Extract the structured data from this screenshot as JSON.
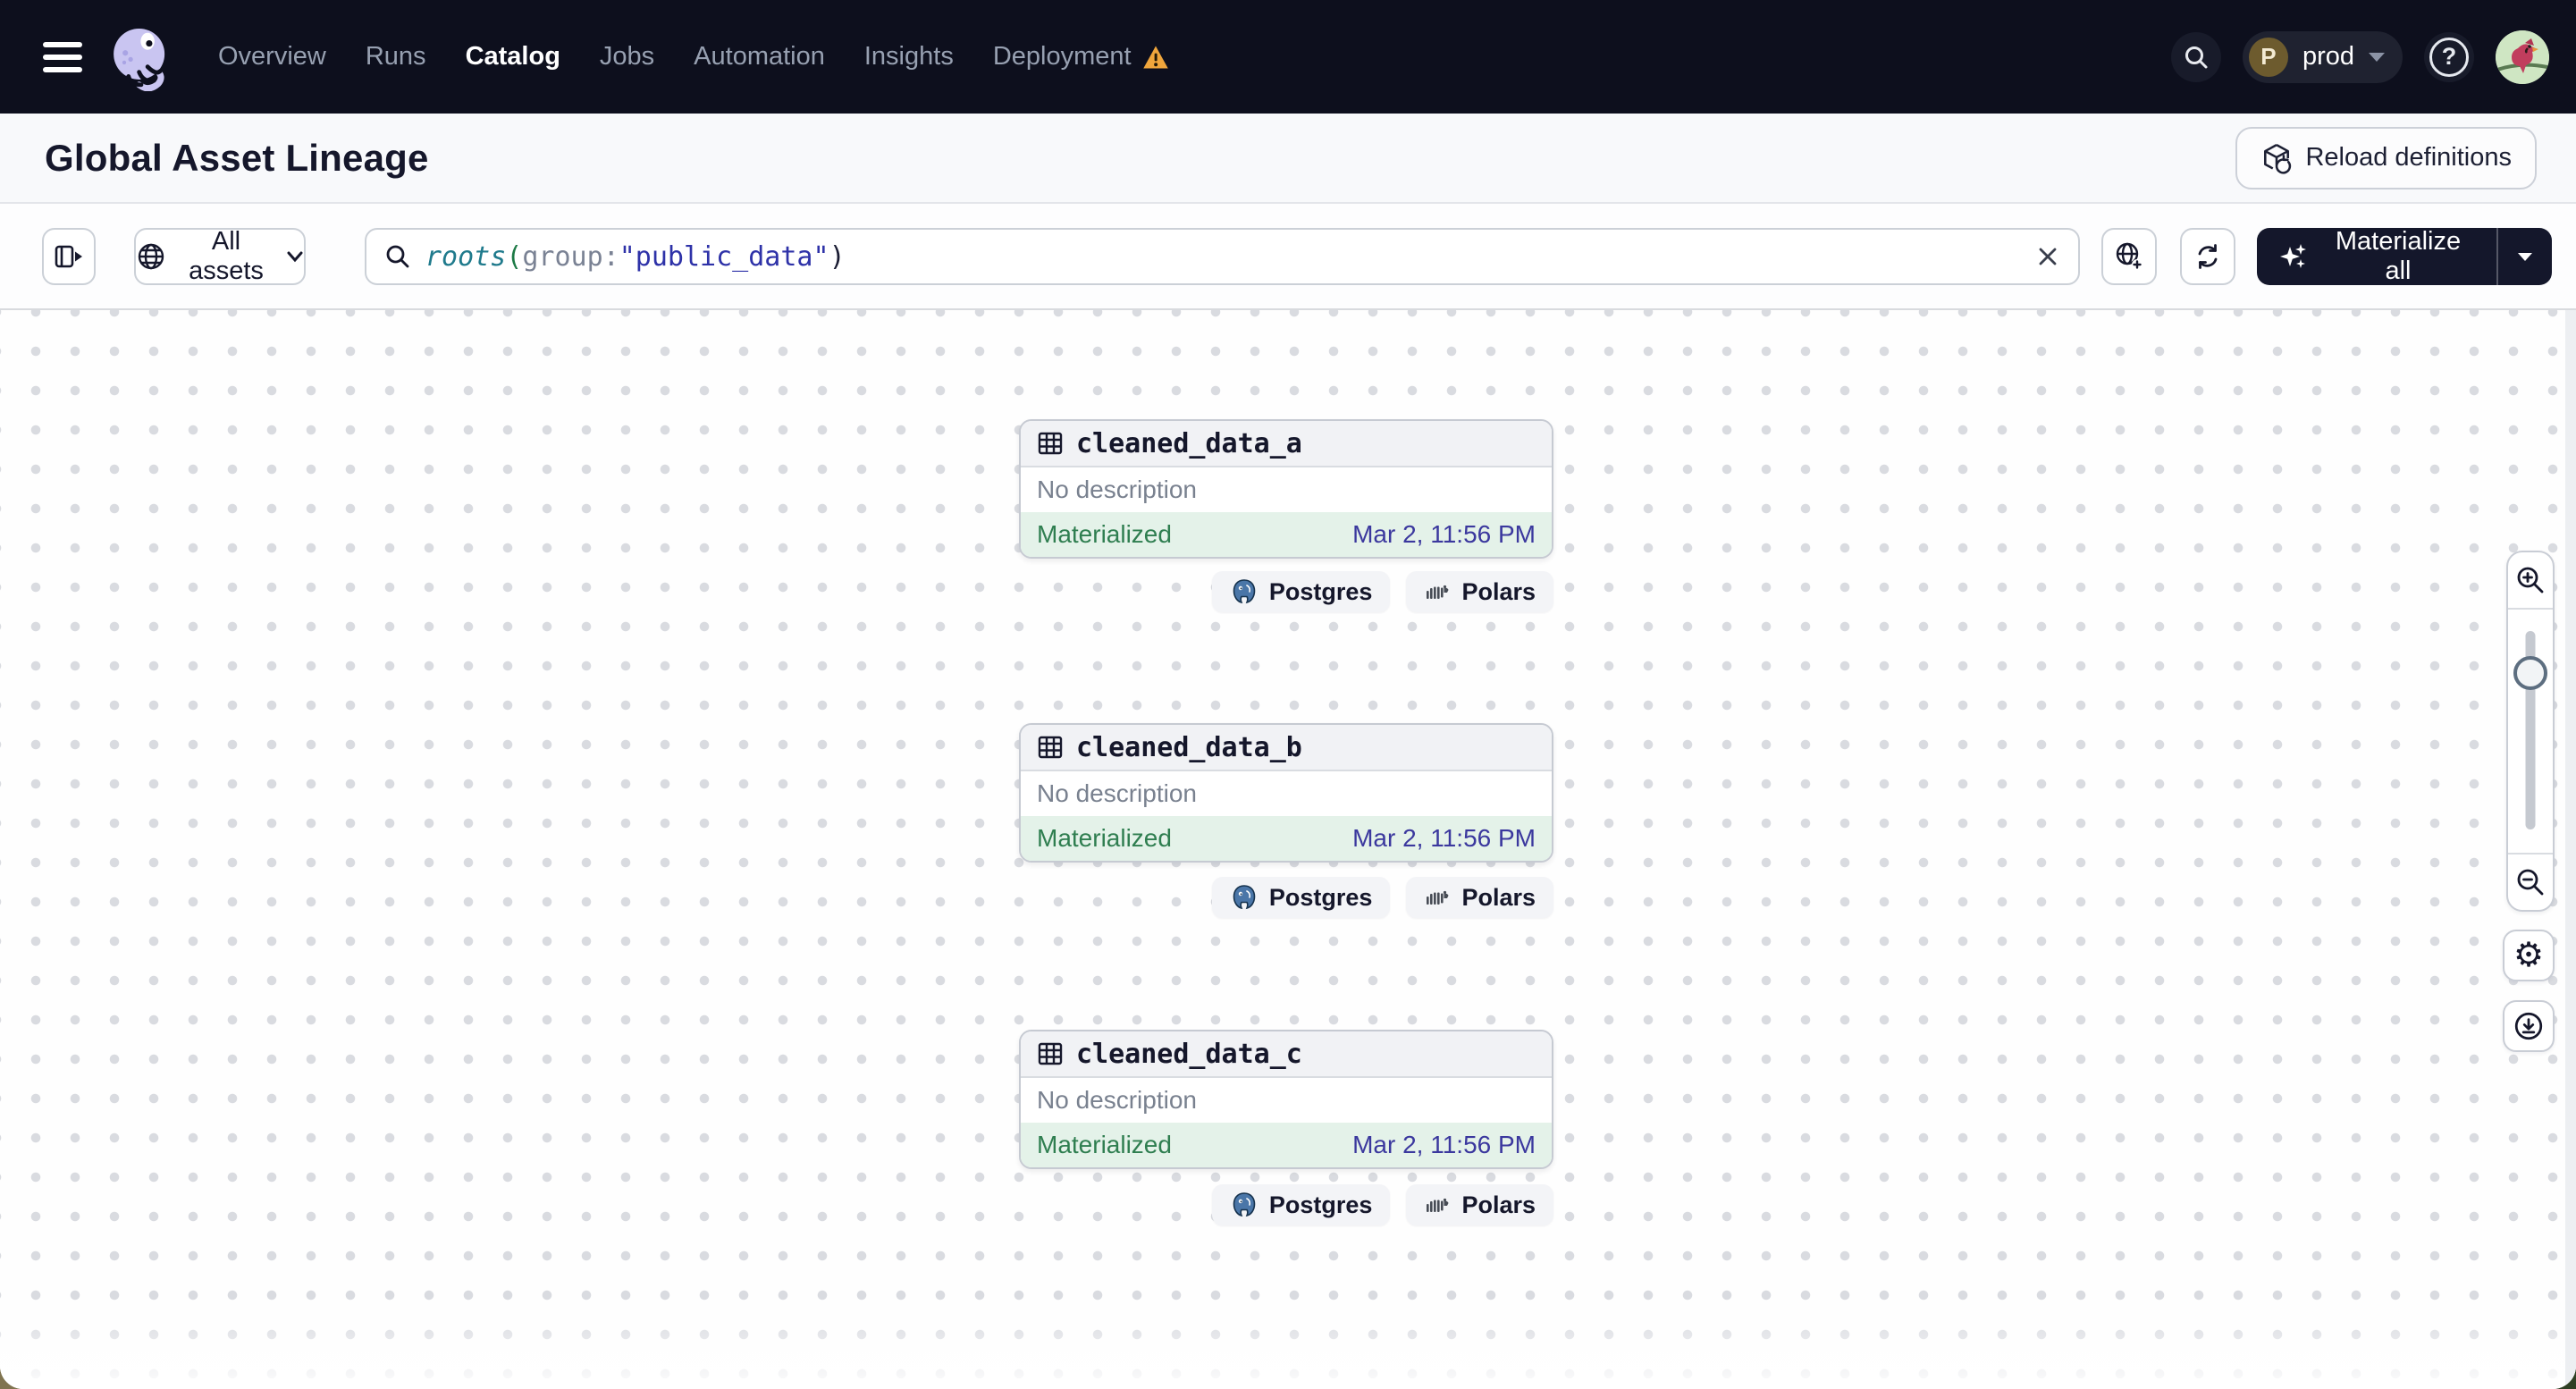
{
  "nav": {
    "items": [
      {
        "label": "Overview"
      },
      {
        "label": "Runs"
      },
      {
        "label": "Catalog",
        "active": true
      },
      {
        "label": "Jobs"
      },
      {
        "label": "Automation"
      },
      {
        "label": "Insights"
      },
      {
        "label": "Deployment",
        "warning": true
      }
    ],
    "env": {
      "initial": "P",
      "name": "prod"
    },
    "help_glyph": "?"
  },
  "header": {
    "title": "Global Asset Lineage",
    "reload_button": "Reload definitions"
  },
  "toolbar": {
    "scope_button": "All assets",
    "query": {
      "fn": "roots",
      "open": "(",
      "arg": "group",
      "colon": ":",
      "value": "\"public_data\"",
      "close": ")"
    },
    "materialize_button": "Materialize all"
  },
  "canvas": {
    "assets": [
      {
        "name": "cleaned_data_a",
        "description": "No description",
        "status": "Materialized",
        "timestamp": "Mar 2, 11:56 PM",
        "tags": [
          {
            "label": "Postgres"
          },
          {
            "label": "Polars"
          }
        ]
      },
      {
        "name": "cleaned_data_b",
        "description": "No description",
        "status": "Materialized",
        "timestamp": "Mar 2, 11:56 PM",
        "tags": [
          {
            "label": "Postgres"
          },
          {
            "label": "Polars"
          }
        ]
      },
      {
        "name": "cleaned_data_c",
        "description": "No description",
        "status": "Materialized",
        "timestamp": "Mar 2, 11:56 PM",
        "tags": [
          {
            "label": "Postgres"
          },
          {
            "label": "Polars"
          }
        ]
      }
    ]
  },
  "icons": {
    "gear_glyph": "⚙"
  },
  "colors": {
    "nav_bg": "#0d0f1d",
    "warning": "#f0a63c",
    "materialized_bg": "#e4f2e9",
    "materialized_text": "#2f7e50",
    "timestamp_text": "#3b389e",
    "dark_button_bg": "#14172b",
    "query_fn": "#1f7a8c",
    "query_value": "#2e32a8",
    "logo_purple": "#c9c5f1"
  }
}
